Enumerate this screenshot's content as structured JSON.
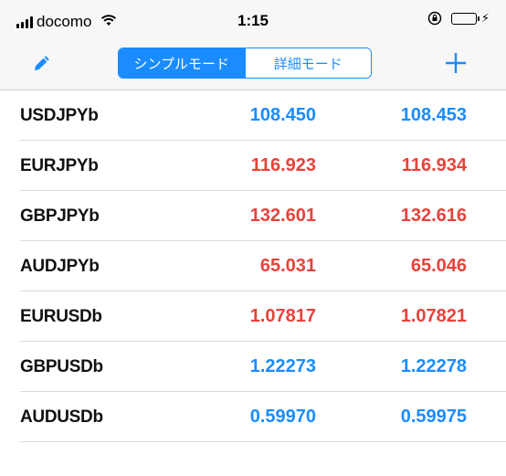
{
  "status_bar": {
    "carrier": "docomo",
    "time": "1:15"
  },
  "nav": {
    "segments": [
      {
        "label": "シンプルモード",
        "selected": true
      },
      {
        "label": "詳細モード",
        "selected": false
      }
    ]
  },
  "colors": {
    "accent": "#1a8cff",
    "price_up": "#1a8cff",
    "price_down": "#e8423a",
    "battery": "#4cd964"
  },
  "quotes": [
    {
      "symbol": "USDJPYb",
      "bid": "108.450",
      "ask": "108.453",
      "direction": "up"
    },
    {
      "symbol": "EURJPYb",
      "bid": "116.923",
      "ask": "116.934",
      "direction": "down"
    },
    {
      "symbol": "GBPJPYb",
      "bid": "132.601",
      "ask": "132.616",
      "direction": "down"
    },
    {
      "symbol": "AUDJPYb",
      "bid": "65.031",
      "ask": "65.046",
      "direction": "down"
    },
    {
      "symbol": "EURUSDb",
      "bid": "1.07817",
      "ask": "1.07821",
      "direction": "down"
    },
    {
      "symbol": "GBPUSDb",
      "bid": "1.22273",
      "ask": "1.22278",
      "direction": "up"
    },
    {
      "symbol": "AUDUSDb",
      "bid": "0.59970",
      "ask": "0.59975",
      "direction": "up"
    }
  ]
}
